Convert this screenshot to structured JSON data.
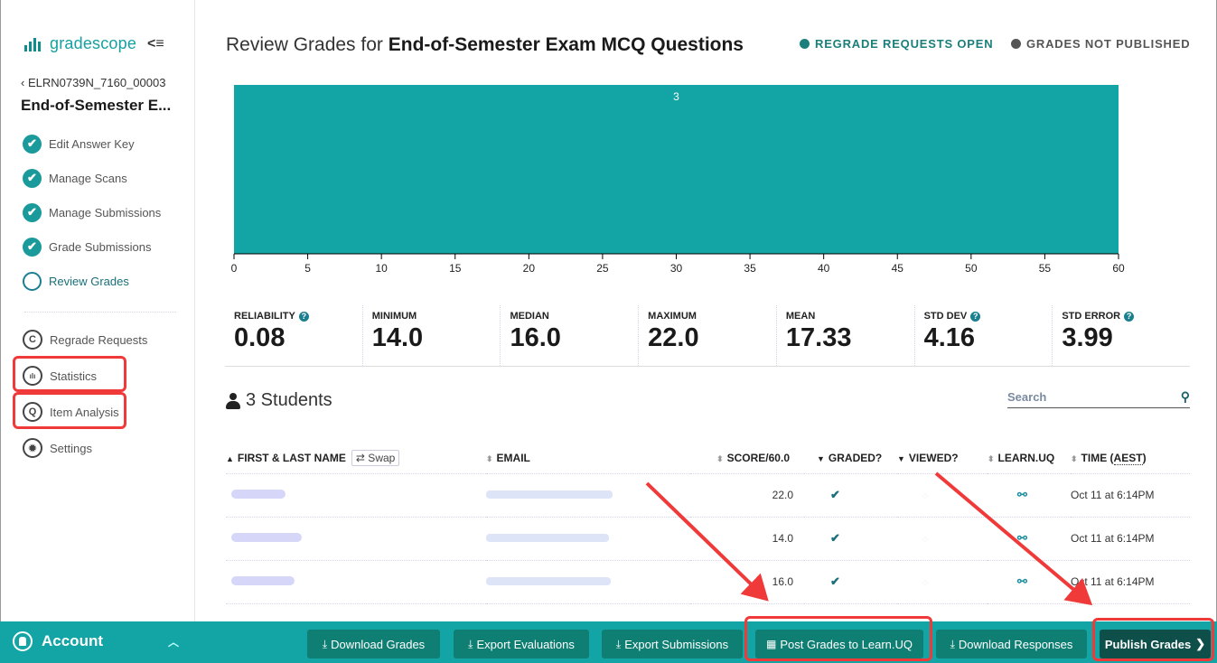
{
  "app": {
    "brand": "gradescope",
    "collapse_label": "<≡"
  },
  "sidebar": {
    "back_label": "‹ ELRN0739N_7160_00003",
    "assignment_title": "End-of-Semester E...",
    "steps": [
      {
        "label": "Edit Answer Key",
        "state": "done"
      },
      {
        "label": "Manage Scans",
        "state": "done"
      },
      {
        "label": "Manage Submissions",
        "state": "done"
      },
      {
        "label": "Grade Submissions",
        "state": "done"
      },
      {
        "label": "Review Grades",
        "state": "current"
      }
    ],
    "tools": [
      {
        "label": "Regrade Requests",
        "icon": "regrade-icon",
        "glyph": "C"
      },
      {
        "label": "Statistics",
        "icon": "statistics-icon",
        "glyph": "ılı"
      },
      {
        "label": "Item Analysis",
        "icon": "item-analysis-icon",
        "glyph": "Q"
      },
      {
        "label": "Settings",
        "icon": "settings-icon",
        "glyph": "✹"
      }
    ]
  },
  "header": {
    "title_prefix": "Review Grades for ",
    "title_bold": "End-of-Semester Exam MCQ Questions",
    "status_regrade": {
      "label": "REGRADE REQUESTS OPEN",
      "color": "#1a7f7a"
    },
    "status_published": {
      "label": "GRADES NOT PUBLISHED",
      "color": "#555555"
    }
  },
  "chart_data": {
    "type": "bar",
    "title": "",
    "xlabel": "",
    "ylabel": "",
    "x_ticks": [
      0,
      5,
      10,
      15,
      20,
      25,
      30,
      35,
      40,
      45,
      50,
      55,
      60
    ],
    "xlim": [
      0,
      60
    ],
    "bins": [
      {
        "from": 0,
        "to": 60,
        "count": 3
      }
    ],
    "bar_color": "#13a5a5",
    "bar_label_color": "#ffffff"
  },
  "stats": [
    {
      "label": "RELIABILITY",
      "value": "0.08",
      "help": true
    },
    {
      "label": "MINIMUM",
      "value": "14.0",
      "help": false
    },
    {
      "label": "MEDIAN",
      "value": "16.0",
      "help": false
    },
    {
      "label": "MAXIMUM",
      "value": "22.0",
      "help": false
    },
    {
      "label": "MEAN",
      "value": "17.33",
      "help": false
    },
    {
      "label": "STD DEV",
      "value": "4.16",
      "help": true
    },
    {
      "label": "STD ERROR",
      "value": "3.99",
      "help": true
    }
  ],
  "students": {
    "count_label": "3 Students",
    "search_placeholder": "Search",
    "columns": {
      "name": "FIRST & LAST NAME",
      "swap": "⇄ Swap",
      "email": "EMAIL",
      "score": "SCORE/60.0",
      "graded": "GRADED?",
      "viewed": "VIEWED?",
      "learn": "LEARN.UQ",
      "time_prefix": "TIME (",
      "time_zone": "AEST",
      "time_suffix": ")"
    },
    "rows": [
      {
        "score": "22.0",
        "graded": "✔",
        "viewed": "◌",
        "learn": "⚯",
        "time": "Oct 11 at 6:14PM"
      },
      {
        "score": "14.0",
        "graded": "✔",
        "viewed": "◌",
        "learn": "⚯",
        "time": "Oct 11 at 6:14PM"
      },
      {
        "score": "16.0",
        "graded": "✔",
        "viewed": "◌",
        "learn": "⚯",
        "time": "Oct 11 at 6:14PM"
      }
    ]
  },
  "footer": {
    "account_label": "Account",
    "buttons": [
      {
        "label": "Download Grades",
        "glyph": "⤓"
      },
      {
        "label": "Export Evaluations",
        "glyph": "⤓"
      },
      {
        "label": "Export Submissions",
        "glyph": "⤓"
      },
      {
        "label": "Post Grades to Learn.UQ",
        "glyph": "▦"
      },
      {
        "label": "Download Responses",
        "glyph": "⤓"
      },
      {
        "label": "Publish Grades",
        "glyph": "❯"
      }
    ]
  },
  "annotations": {
    "highlight_color": "#f03a3a"
  }
}
